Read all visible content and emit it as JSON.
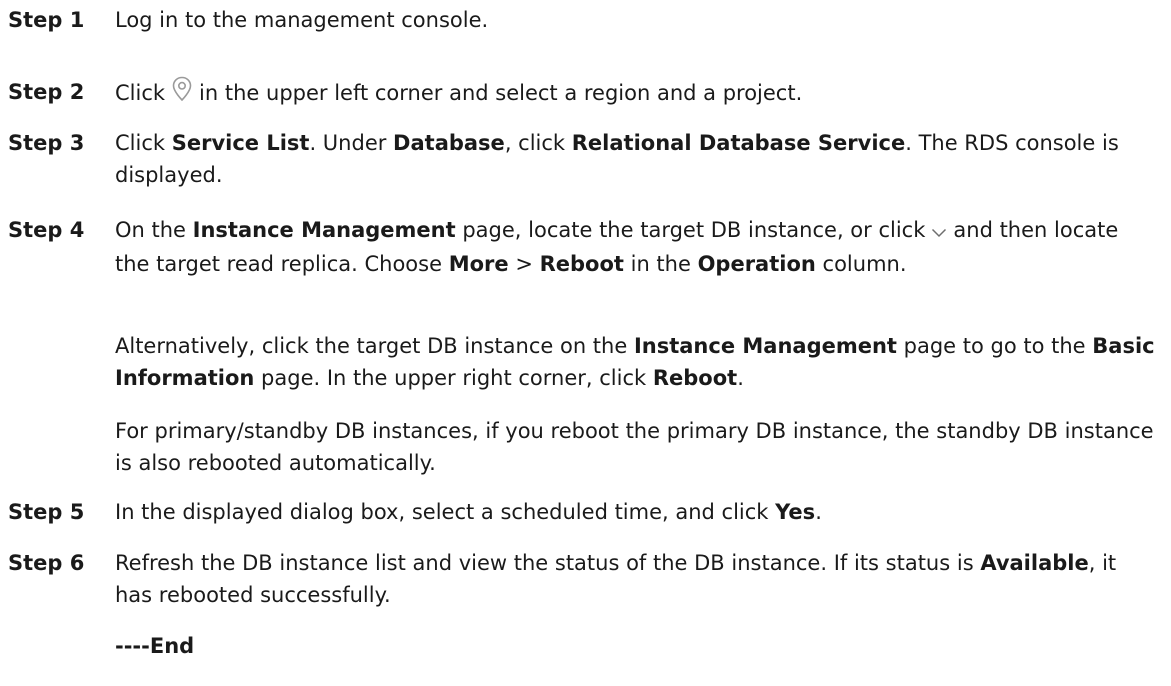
{
  "steps": [
    {
      "label": "Step 1",
      "text": "Log in to the management console."
    },
    {
      "label": "Step 2",
      "pre": "Click",
      "post": "in the upper left corner and select a region and a project.",
      "icon": "location-pin-icon"
    },
    {
      "label": "Step 3",
      "t1": "Click ",
      "b1": "Service List",
      "t2": ". Under ",
      "b2": "Database",
      "t3": ", click ",
      "b3": "Relational Database Service",
      "t4": ". The RDS console is displayed."
    },
    {
      "label": "Step 4",
      "t1": "On the ",
      "b1": "Instance Management",
      "t2": " page, locate the target DB instance, or click",
      "icon": "chevron-down-icon",
      "t3": "and then locate the target read replica. Choose ",
      "b2": "More",
      "t4": " > ",
      "b3": "Reboot",
      "t5": " in the ",
      "b4": "Operation",
      "t6": " column."
    },
    {
      "label": "Step 5",
      "t1": "In the displayed dialog box, select a scheduled time, and click ",
      "b1": "Yes",
      "t2": "."
    },
    {
      "label": "Step 6",
      "t1": "Refresh the DB instance list and view the status of the DB instance. If its status is ",
      "b1": "Available",
      "t2": ", it has rebooted successfully."
    }
  ],
  "step4_alt": {
    "t1": "Alternatively, click the target DB instance on the ",
    "b1": "Instance Management",
    "t2": " page to go to the ",
    "b2": "Basic Information",
    "t3": " page. In the upper right corner, click ",
    "b3": "Reboot",
    "t4": "."
  },
  "step4_note": "For primary/standby DB instances, if you reboot the primary DB instance, the standby DB instance is also rebooted automatically.",
  "end_marker": "----End"
}
